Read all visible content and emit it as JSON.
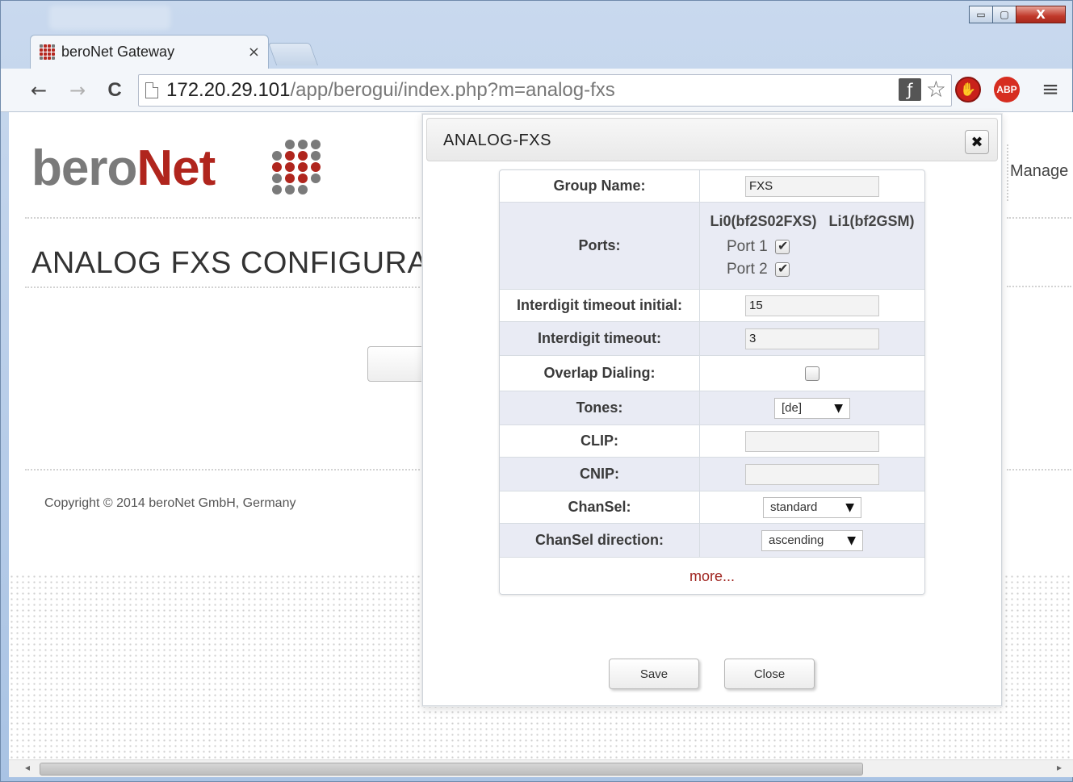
{
  "browser": {
    "tab": {
      "title": "beroNet Gateway",
      "close": "×"
    },
    "window_controls": {
      "minimize": "▭",
      "maximize": "▢",
      "close": "X"
    },
    "nav": {
      "back": "←",
      "forward": "→",
      "reload": "C"
    },
    "address": {
      "host": "172.20.29.101",
      "path": "/app/berogui/index.php?m=analog-fxs"
    },
    "icons": {
      "flash": "flash-blocked-icon",
      "star": "☆",
      "stop_ext": "stop-extension-icon",
      "abp": "ABP",
      "menu": "≡"
    }
  },
  "page": {
    "logo": {
      "part1": "bero",
      "part2": "Net"
    },
    "title": "ANALOG FXS CONFIGURAT",
    "copyright": "Copyright © 2014 beroNet GmbH, Germany",
    "side_link": "Manage",
    "colors": {
      "brand_red": "#b0251d",
      "brand_gray": "#7a7a7a"
    }
  },
  "modal": {
    "title": "ANALOG-FXS",
    "close_icon": "✖",
    "rows": {
      "group_name": {
        "label": "Group Name:",
        "value": "FXS"
      },
      "ports": {
        "label": "Ports:",
        "columns": [
          "Li0(bf2S02FXS)",
          "Li1(bf2GSM)"
        ],
        "items": [
          {
            "label": "Port 1",
            "checked": true
          },
          {
            "label": "Port 2",
            "checked": true
          }
        ]
      },
      "interdigit_initial": {
        "label": "Interdigit timeout initial:",
        "value": "15"
      },
      "interdigit": {
        "label": "Interdigit timeout:",
        "value": "3"
      },
      "overlap": {
        "label": "Overlap Dialing:",
        "checked": false
      },
      "tones": {
        "label": "Tones:",
        "value": "[de]"
      },
      "clip": {
        "label": "CLIP:",
        "value": ""
      },
      "cnip": {
        "label": "CNIP:",
        "value": ""
      },
      "chansel": {
        "label": "ChanSel:",
        "value": "standard"
      },
      "chansel_dir": {
        "label": "ChanSel direction:",
        "value": "ascending"
      }
    },
    "more": "more...",
    "buttons": {
      "save": "Save",
      "close": "Close"
    }
  },
  "scrollbar": {
    "left": "◂",
    "right": "▸"
  }
}
